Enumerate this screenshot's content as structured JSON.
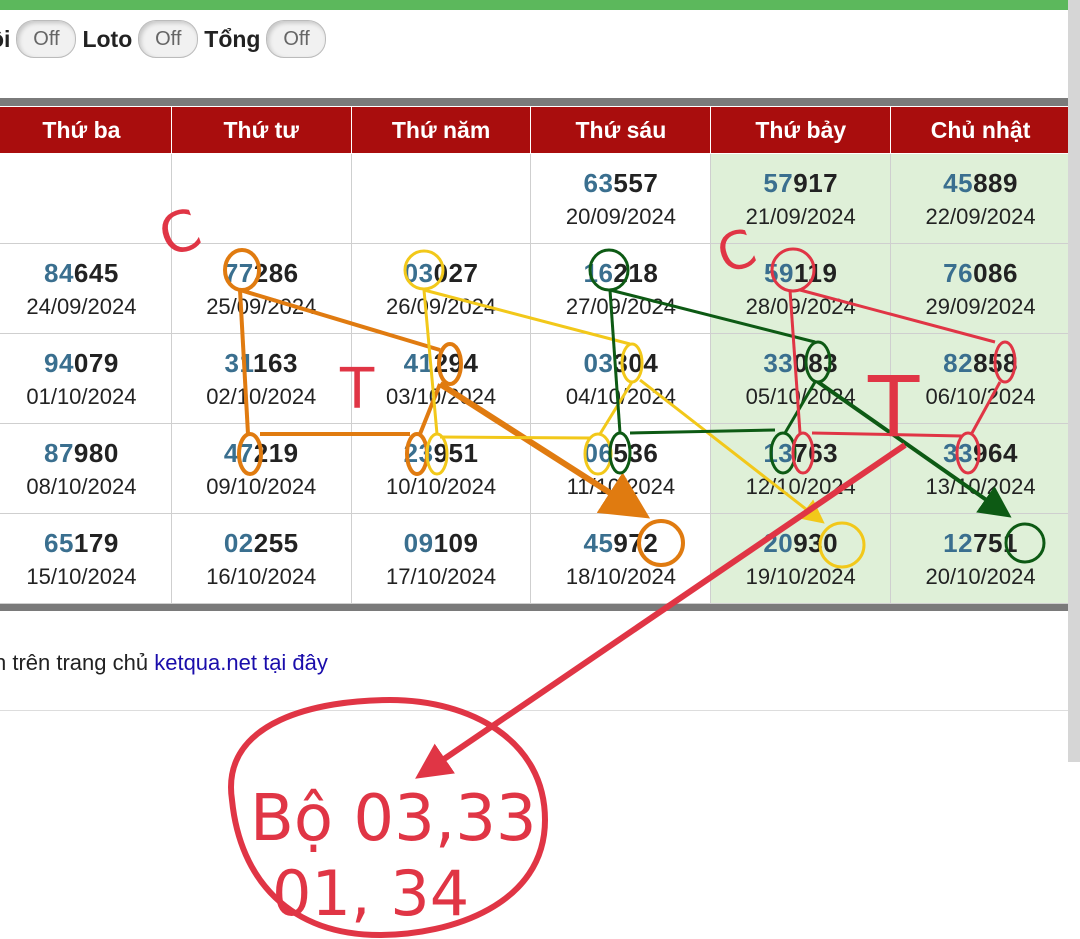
{
  "filters": [
    {
      "label": "ôi",
      "state": "Off"
    },
    {
      "label": "Loto",
      "state": "Off"
    },
    {
      "label": "Tổng",
      "state": "Off"
    }
  ],
  "weekdays": [
    "Thứ ba",
    "Thứ tư",
    "Thứ năm",
    "Thứ sáu",
    "Thứ bảy",
    "Chủ nhật"
  ],
  "rows": [
    [
      null,
      null,
      null,
      {
        "lead": "63",
        "rest": "557",
        "date": "20/09/2024"
      },
      {
        "lead": "57",
        "rest": "917",
        "date": "21/09/2024"
      },
      {
        "lead": "45",
        "rest": "889",
        "date": "22/09/2024"
      }
    ],
    [
      {
        "lead": "84",
        "rest": "645",
        "date": "24/09/2024"
      },
      {
        "lead": "77",
        "rest": "286",
        "date": "25/09/2024"
      },
      {
        "lead": "03",
        "rest": "027",
        "date": "26/09/2024"
      },
      {
        "lead": "16",
        "rest": "218",
        "date": "27/09/2024"
      },
      {
        "lead": "59",
        "rest": "119",
        "date": "28/09/2024"
      },
      {
        "lead": "76",
        "rest": "086",
        "date": "29/09/2024"
      }
    ],
    [
      {
        "lead": "94",
        "rest": "079",
        "date": "01/10/2024"
      },
      {
        "lead": "31",
        "rest": "163",
        "date": "02/10/2024"
      },
      {
        "lead": "41",
        "rest": "294",
        "date": "03/10/2024"
      },
      {
        "lead": "03",
        "rest": "304",
        "date": "04/10/2024"
      },
      {
        "lead": "33",
        "rest": "083",
        "date": "05/10/2024"
      },
      {
        "lead": "82",
        "rest": "858",
        "date": "06/10/2024"
      }
    ],
    [
      {
        "lead": "87",
        "rest": "980",
        "date": "08/10/2024"
      },
      {
        "lead": "47",
        "rest": "219",
        "date": "09/10/2024"
      },
      {
        "lead": "23",
        "rest": "951",
        "date": "10/10/2024"
      },
      {
        "lead": "06",
        "rest": "536",
        "date": "11/10/2024"
      },
      {
        "lead": "13",
        "rest": "763",
        "date": "12/10/2024"
      },
      {
        "lead": "33",
        "rest": "964",
        "date": "13/10/2024"
      }
    ],
    [
      {
        "lead": "65",
        "rest": "179",
        "date": "15/10/2024"
      },
      {
        "lead": "02",
        "rest": "255",
        "date": "16/10/2024"
      },
      {
        "lead": "09",
        "rest": "109",
        "date": "17/10/2024"
      },
      {
        "lead": "45",
        "rest": "972",
        "date": "18/10/2024"
      },
      {
        "lead": "20",
        "rest": "930",
        "date": "19/10/2024"
      },
      {
        "lead": "12",
        "rest": "751",
        "date": "20/10/2024"
      }
    ]
  ],
  "note": {
    "text": "n trên trang chủ ",
    "link": "ketqua.net tại đây"
  },
  "handwriting": {
    "mark_c1": "C",
    "mark_c2": "C",
    "mark_t1": "T",
    "mark_t2": "T",
    "answer_line1": "Bộ 03,33",
    "answer_line2": "01, 34"
  },
  "colors": {
    "header_bg": "#a90d0d",
    "weekend_bg": "#dff0d8",
    "number_highlight": "#3a6f8f",
    "top_bar": "#5cb85c",
    "ink_orange": "#e07b10",
    "ink_yellow": "#f2c81a",
    "ink_green": "#0d5a14",
    "ink_red": "#e03545"
  }
}
